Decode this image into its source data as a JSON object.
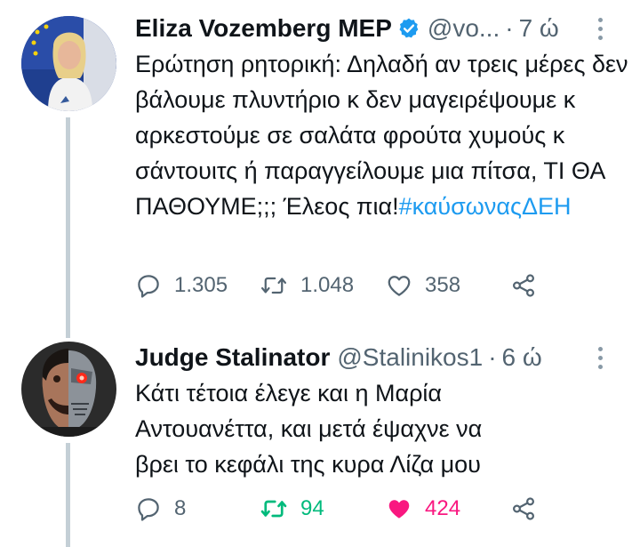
{
  "tweets": [
    {
      "author_name": "Eliza Vozemberg MEP",
      "verified": true,
      "handle": "@vo...",
      "separator": "·",
      "time": "7 ώ",
      "text_main": "Ερώτηση ρητορική: Δηλαδή αν τρεις μέρες δεν βάλουμε πλυντήριο κ δεν μαγειρέψουμε κ αρκεστούμε σε σαλάτα φρούτα χυμούς κ σάντουιτς ή παραγγείλουμε μια πίτσα, ΤΙ ΘΑ ΠΑΘΟΥΜΕ;;; Έλεος πια!",
      "hashtag": "#καύσωναςΔΕΗ",
      "replies": "1.305",
      "retweets": "1.048",
      "likes": "358",
      "icons": [
        "reply-icon",
        "retweet-icon",
        "like-icon",
        "share-icon"
      ]
    },
    {
      "author_name": "Judge Stalinator",
      "verified": false,
      "handle": "@Stalinikos1",
      "separator": "·",
      "time": "6 ώ",
      "text_main": "Κάτι τέτοια έλεγε και η Μαρία Αντουανέττα, και μετά έψαχνε να βρει το κεφάλι της κυρα Λίζα μου",
      "replies": "8",
      "retweets": "94",
      "likes": "424",
      "retweeted": true,
      "liked": true,
      "icons": [
        "reply-icon",
        "retweet-icon",
        "like-filled-icon",
        "share-icon"
      ]
    }
  ],
  "colors": {
    "link": "#1d9bf0",
    "secondary_text": "#536471",
    "retweet_active": "#00ba7c",
    "like_active": "#f91880",
    "verified_badge": "#1d9bf0",
    "thread_line": "#c4cfd6"
  }
}
